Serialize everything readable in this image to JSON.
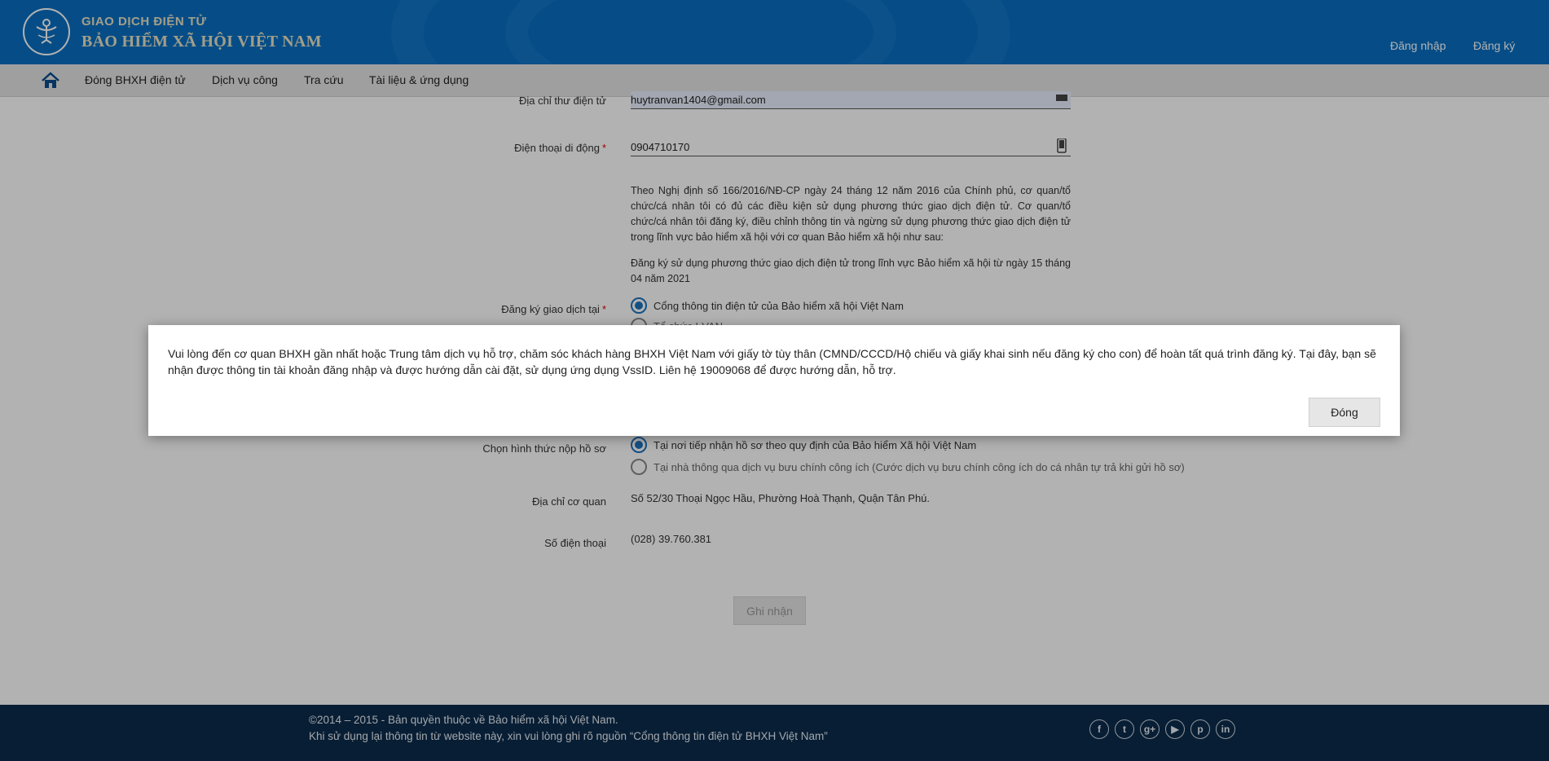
{
  "header": {
    "brand_top": "GIAO DỊCH ĐIỆN TỬ",
    "brand_main": "BẢO HIỂM XÃ HỘI VIỆT NAM",
    "login_label": "Đăng nhập",
    "register_label": "Đăng ký",
    "colors": {
      "background": "#0a6fc2",
      "brand_text": "#e9e3c5"
    }
  },
  "nav": {
    "items": [
      {
        "label": "Đóng BHXH điện tử"
      },
      {
        "label": "Dịch vụ công"
      },
      {
        "label": "Tra cứu"
      },
      {
        "label": "Tài liệu & ứng dụng"
      }
    ]
  },
  "form": {
    "email_label": "Địa chỉ thư điện tử",
    "email_value": "huytranvan1404@gmail.com",
    "phone_label": "Điện thoại di động",
    "phone_value": "0904710170",
    "decree_text": "Theo Nghị định số 166/2016/NĐ-CP ngày 24 tháng 12 năm 2016 của Chính phủ, cơ quan/tổ chức/cá nhân tôi có đủ các điều kiện sử dụng phương thức giao dịch điện tử. Cơ quan/tổ chức/cá nhân tôi đăng ký, điều chỉnh thông tin và ngừng sử dụng phương thức giao dịch điện tử trong lĩnh vực bảo hiểm xã hội với cơ quan Bảo hiểm xã hội như sau:",
    "register_date_text": "Đăng ký sử dụng phương thức giao dịch điện tử trong lĩnh vực Bảo hiểm xã hội từ ngày 15 tháng 04 năm 2021",
    "transaction_label": "Đăng ký giao dịch tại",
    "transaction_options": [
      {
        "label": "Cổng thông tin điện tử của Bảo hiểm xã hội Việt Nam",
        "checked": true
      },
      {
        "label": "Tổ chức I-VAN",
        "checked": false
      }
    ],
    "submit_method_label": "Chọn hình thức nộp hồ sơ",
    "submit_options": [
      {
        "label": "Tại nơi tiếp nhận hồ sơ theo quy định của Bảo hiểm Xã hội Việt Nam",
        "checked": true
      },
      {
        "label": "Tại nhà thông qua dịch vụ bưu chính công ích (Cước dịch vụ bưu chính công ích do cá nhân tự trả khi gửi hồ sơ)",
        "checked": false
      }
    ],
    "agency_address_label": "Địa chỉ cơ quan",
    "agency_address_value": "Số 52/30 Thoại Ngọc Hầu, Phường Hoà Thạnh, Quận Tân Phú.",
    "agency_phone_label": "Số điện thoại",
    "agency_phone_value": "(028) 39.760.381",
    "submit_button": "Ghi nhận",
    "required_mark": "*"
  },
  "modal": {
    "message": "Vui lòng đến cơ quan BHXH gần nhất hoặc Trung tâm dịch vụ hỗ trợ, chăm sóc khách hàng BHXH Việt Nam với giấy tờ tùy thân (CMND/CCCD/Hộ chiếu và giấy khai sinh nếu đăng ký cho con) để hoàn tất quá trình đăng ký. Tại đây, bạn sẽ nhận được thông tin tài khoản đăng nhập và được hướng dẫn cài đặt, sử dụng ứng dụng VssID. Liên hệ 19009068 để được hướng dẫn, hỗ trợ.",
    "close_button": "Đóng"
  },
  "footer": {
    "copyright": "©2014 – 2015 - Bản quyền thuộc về Bảo hiểm xã hội Việt Nam.",
    "notice": "Khi sử dụng lại thông tin từ website này, xin vui lòng ghi rõ nguồn “Cổng thông tin điện tử BHXH Việt Nam”",
    "social_icons": [
      {
        "name": "facebook-icon",
        "glyph": "f"
      },
      {
        "name": "twitter-icon",
        "glyph": "t"
      },
      {
        "name": "google-plus-icon",
        "glyph": "g+"
      },
      {
        "name": "youtube-icon",
        "glyph": "▶"
      },
      {
        "name": "pinterest-icon",
        "glyph": "p"
      },
      {
        "name": "linkedin-icon",
        "glyph": "in"
      }
    ],
    "colors": {
      "background": "#0c2b4b"
    }
  }
}
